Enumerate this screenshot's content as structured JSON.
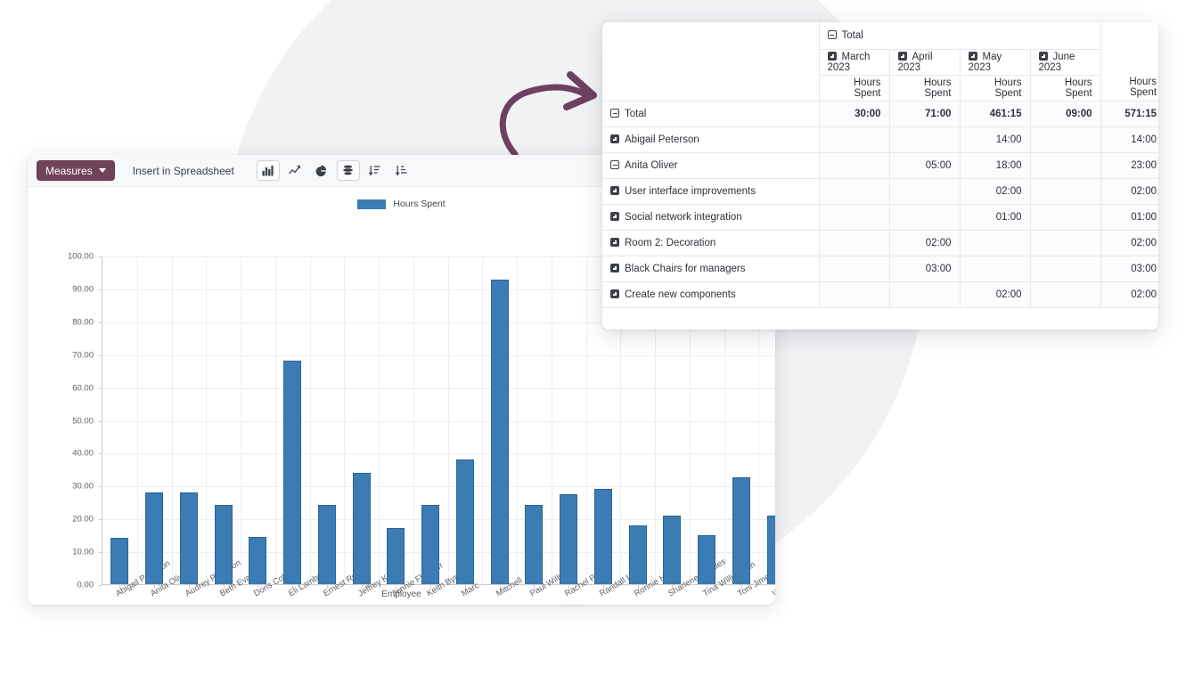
{
  "chart_panel": {
    "toolbar": {
      "measures_label": "Measures",
      "insert_label": "Insert in Spreadsheet",
      "icons": [
        {
          "name": "bar-chart-icon",
          "active": true
        },
        {
          "name": "line-chart-icon",
          "active": false
        },
        {
          "name": "pie-chart-icon",
          "active": false
        },
        {
          "name": "stacked-icon",
          "active": true
        },
        {
          "name": "sort-descending-icon",
          "active": false
        },
        {
          "name": "sort-ascending-icon",
          "active": false
        }
      ]
    }
  },
  "chart_data": {
    "type": "bar",
    "title": "",
    "legend": [
      "Hours Spent"
    ],
    "legend_position": "top-center",
    "grid": true,
    "xlabel": "Employee",
    "ylabel": "",
    "ylim": [
      0,
      100
    ],
    "yticks": [
      "0.00",
      "10.00",
      "20.00",
      "30.00",
      "40.00",
      "50.00",
      "60.00",
      "70.00",
      "80.00",
      "90.00",
      "100.00"
    ],
    "color": "#3b7cb4",
    "categories": [
      "Abigail Peterson",
      "Anita Oliver",
      "Audrey Peterson",
      "Beth Evans",
      "Doris Cole",
      "Eli Lambert",
      "Ernest Reed",
      "Jeffrey Kelly",
      "Jennie Fletcher",
      "Keith Byrd",
      "Marc",
      "Mitchell",
      "Paul Williams",
      "Rachel Perry",
      "Randall Lewis",
      "Ronnie Hart",
      "Sharlene Rhodes",
      "Tina Williamson",
      "Toni Jimenez",
      "Walter Horton"
    ],
    "series": [
      {
        "name": "Hours Spent",
        "values": [
          14,
          28,
          28,
          24,
          14.5,
          68,
          24,
          34,
          17,
          24,
          38,
          92.7,
          24,
          27.5,
          29,
          18,
          21,
          15,
          32.5,
          21
        ]
      }
    ]
  },
  "pivot": {
    "corner_label": "",
    "total_header": "Total",
    "column_groups": [
      "March 2023",
      "April 2023",
      "May 2023",
      "June 2023"
    ],
    "measure_label": "Hours Spent",
    "measure_columns": [
      "Hours Spent",
      "Hours Spent",
      "Hours Spent",
      "Hours Spent",
      "Hours Spent"
    ],
    "rows": [
      {
        "label": "Total",
        "indent": 0,
        "toggle": "minus",
        "bold": true,
        "values": [
          "30:00",
          "71:00",
          "461:15",
          "09:00",
          "571:15"
        ]
      },
      {
        "label": "Abigail Peterson",
        "indent": 1,
        "toggle": "plus",
        "bold": false,
        "values": [
          "",
          "",
          "14:00",
          "",
          "14:00"
        ]
      },
      {
        "label": "Anita Oliver",
        "indent": 1,
        "toggle": "minus",
        "bold": false,
        "values": [
          "",
          "05:00",
          "18:00",
          "",
          "23:00"
        ]
      },
      {
        "label": "User interface improvements",
        "indent": 2,
        "toggle": "plus",
        "bold": false,
        "values": [
          "",
          "",
          "02:00",
          "",
          "02:00"
        ]
      },
      {
        "label": "Social network integration",
        "indent": 2,
        "toggle": "plus",
        "bold": false,
        "values": [
          "",
          "",
          "01:00",
          "",
          "01:00"
        ]
      },
      {
        "label": "Room 2: Decoration",
        "indent": 2,
        "toggle": "plus",
        "bold": false,
        "values": [
          "",
          "02:00",
          "",
          "",
          "02:00"
        ]
      },
      {
        "label": "Black Chairs for managers",
        "indent": 2,
        "toggle": "plus",
        "bold": false,
        "values": [
          "",
          "03:00",
          "",
          "",
          "03:00"
        ]
      },
      {
        "label": "Create new components",
        "indent": 2,
        "toggle": "plus",
        "bold": false,
        "values": [
          "",
          "",
          "02:00",
          "",
          "02:00"
        ]
      }
    ]
  },
  "decor": {
    "arrow_name": "curved-arrow-annotation",
    "arrow_color": "#6e4060",
    "blob_color": "#f1f2f4"
  }
}
